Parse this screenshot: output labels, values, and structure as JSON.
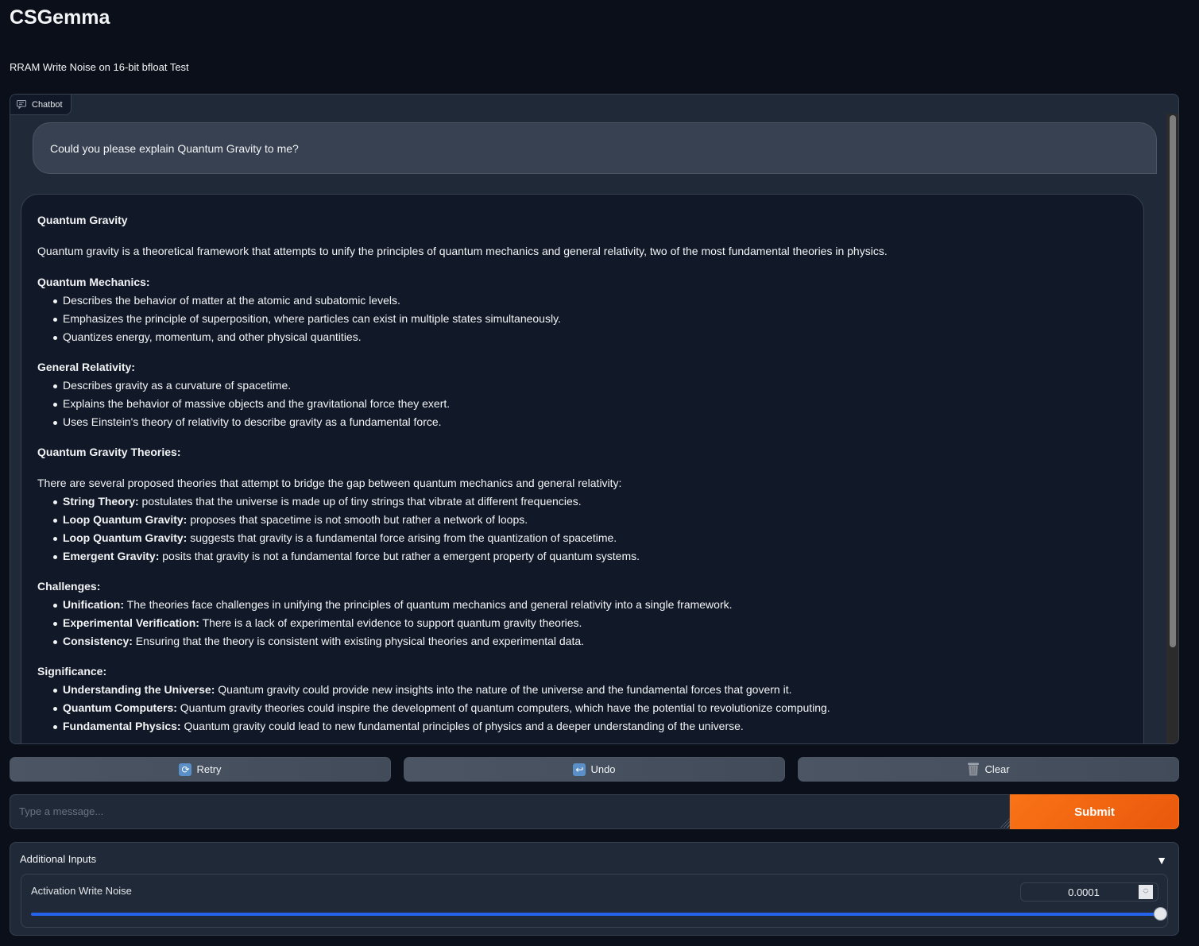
{
  "app": {
    "title": "CSGemma",
    "subtitle": "RRAM Write Noise on 16-bit bfloat Test"
  },
  "chatbot": {
    "label": "Chatbot",
    "label_icon": "chat-icon",
    "user_message": "Could you please explain Quantum Gravity to me?",
    "response": {
      "title": "Quantum Gravity",
      "intro": "Quantum gravity is a theoretical framework that attempts to unify the principles of quantum mechanics and general relativity, two of the most fundamental theories in physics.",
      "sections": [
        {
          "heading": "Quantum Mechanics:",
          "items": [
            {
              "bold": "",
              "text": "Describes the behavior of matter at the atomic and subatomic levels."
            },
            {
              "bold": "",
              "text": "Emphasizes the principle of superposition, where particles can exist in multiple states simultaneously."
            },
            {
              "bold": "",
              "text": "Quantizes energy, momentum, and other physical quantities."
            }
          ]
        },
        {
          "heading": "General Relativity:",
          "items": [
            {
              "bold": "",
              "text": "Describes gravity as a curvature of spacetime."
            },
            {
              "bold": "",
              "text": "Explains the behavior of massive objects and the gravitational force they exert."
            },
            {
              "bold": "",
              "text": "Uses Einstein's theory of relativity to describe gravity as a fundamental force."
            }
          ]
        }
      ],
      "theories_heading": "Quantum Gravity Theories:",
      "theories_intro": "There are several proposed theories that attempt to bridge the gap between quantum mechanics and general relativity:",
      "theories": [
        {
          "bold": "String Theory:",
          "text": " postulates that the universe is made up of tiny strings that vibrate at different frequencies."
        },
        {
          "bold": "Loop Quantum Gravity:",
          "text": " proposes that spacetime is not smooth but rather a network of loops."
        },
        {
          "bold": "Loop Quantum Gravity:",
          "text": " suggests that gravity is a fundamental force arising from the quantization of spacetime."
        },
        {
          "bold": "Emergent Gravity:",
          "text": " posits that gravity is not a fundamental force but rather a emergent property of quantum systems."
        }
      ],
      "challenges_heading": "Challenges:",
      "challenges": [
        {
          "bold": "Unification:",
          "text": " The theories face challenges in unifying the principles of quantum mechanics and general relativity into a single framework."
        },
        {
          "bold": "Experimental Verification:",
          "text": " There is a lack of experimental evidence to support quantum gravity theories."
        },
        {
          "bold": "Consistency:",
          "text": " Ensuring that the theory is consistent with existing physical theories and experimental data."
        }
      ],
      "significance_heading": "Significance:",
      "significance": [
        {
          "bold": "Understanding the Universe:",
          "text": " Quantum gravity could provide new insights into the nature of the universe and the fundamental forces that govern it."
        },
        {
          "bold": "Quantum Computers:",
          "text": " Quantum gravity theories could inspire the development of quantum computers, which have the potential to revolutionize computing."
        },
        {
          "bold": "Fundamental Physics:",
          "text": " Quantum gravity could lead to new fundamental principles of physics and a deeper understanding of the universe."
        }
      ]
    }
  },
  "actions": {
    "retry": {
      "label": "Retry",
      "icon": "retry-icon",
      "glyph": "⟳"
    },
    "undo": {
      "label": "Undo",
      "icon": "undo-icon",
      "glyph": "↩"
    },
    "clear": {
      "label": "Clear",
      "icon": "trash-icon",
      "glyph": "🗑"
    }
  },
  "input": {
    "placeholder": "Type a message...",
    "value": "",
    "submit_label": "Submit"
  },
  "additional_inputs": {
    "title": "Additional Inputs",
    "caret": "▼",
    "activation_write_noise": {
      "label": "Activation Write Noise",
      "value": "0.0001",
      "slider_fraction": 1.0
    }
  },
  "colors": {
    "accent": "#f97316",
    "slider": "#2563eb",
    "background": "#0b0f19",
    "panel": "#1f2937"
  }
}
